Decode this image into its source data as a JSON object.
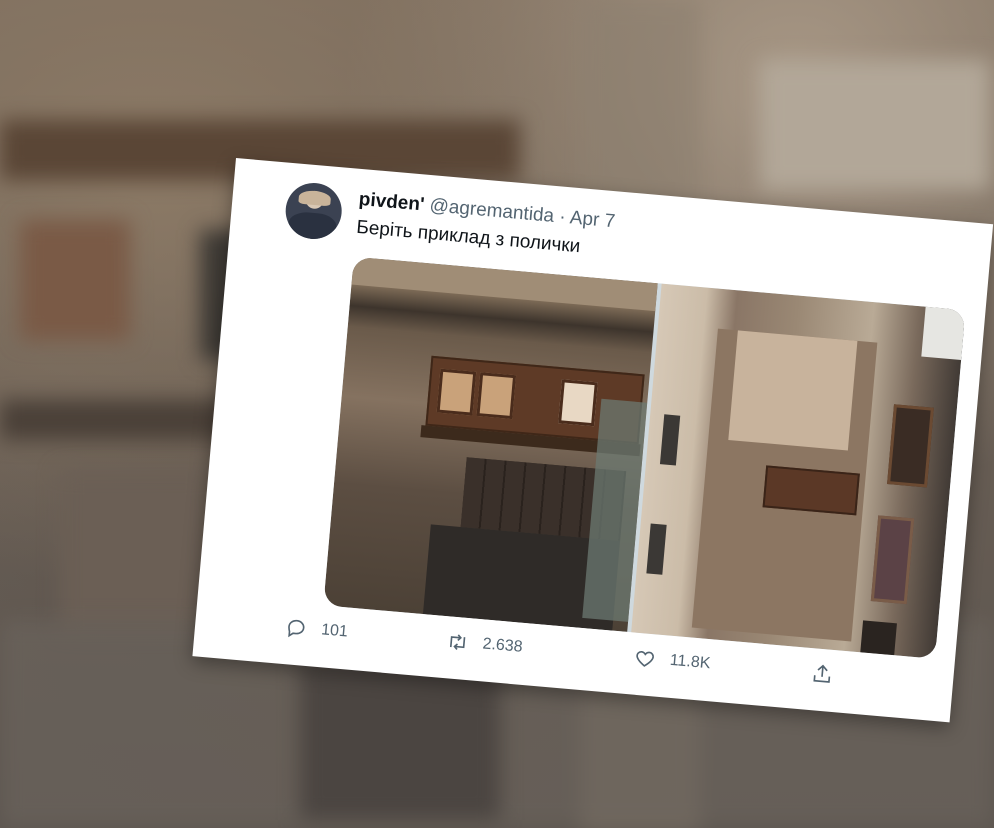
{
  "tweet": {
    "display_name": "pivden'",
    "handle": "@agremantida",
    "separator": "·",
    "date": "Apr 7",
    "text": "Беріть приклад з полички",
    "actions": {
      "replies": "101",
      "retweets": "2.638",
      "likes": "11.8K"
    }
  },
  "icons": [
    "reply-icon",
    "retweet-icon",
    "like-icon",
    "share-icon"
  ]
}
